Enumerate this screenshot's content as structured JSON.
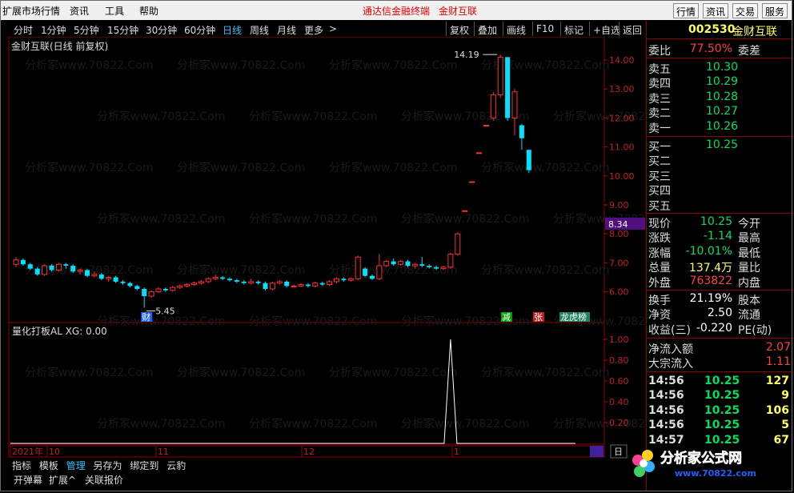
{
  "menubar": {
    "items": [
      "扩展市场行情",
      "资讯",
      "工具",
      "帮助"
    ],
    "banner_left": "通达信金融终端",
    "banner_right": "金财互联",
    "right_buttons": [
      "行情",
      "资讯",
      "交易",
      "服务"
    ]
  },
  "toolbar": {
    "timeframes": [
      "分时",
      "1分钟",
      "5分钟",
      "15分钟",
      "30分钟",
      "60分钟",
      "日线",
      "周线",
      "月线",
      "更多"
    ],
    "active": "日线",
    "more_arrow": ">",
    "buttons": [
      "复权",
      "叠加",
      "画线",
      "F10",
      "标记",
      "+自选",
      "返回"
    ]
  },
  "chart": {
    "title": "金财互联(日线 前复权)",
    "high_label": "14.19",
    "low_label": "5.45",
    "current_price_tag": "8.34",
    "price_axis": [
      "14.00",
      "13.00",
      "12.00",
      "11.00",
      "10.00",
      "9.00",
      "8.00",
      "7.00",
      "6.00"
    ],
    "date_axis": [
      "2021年",
      "10",
      "11",
      "12",
      "1"
    ],
    "markers": [
      {
        "label": "财",
        "color": "#2060ff"
      },
      {
        "label": "减",
        "color": "#00a000"
      },
      {
        "label": "张",
        "color": "#c02020"
      },
      {
        "label": "龙虎榜",
        "color": "#208060"
      }
    ],
    "watermark": "分析家www.70822.Com"
  },
  "indicator": {
    "title": "量化打板AL  XG: 0.00",
    "axis": [
      "1.00",
      "0.80",
      "0.60",
      "0.40",
      "0.20"
    ]
  },
  "bottom": {
    "tabs": [
      "指标",
      "模板",
      "管理",
      "另存为",
      "绑定到",
      "云豹"
    ],
    "tabs2": [
      "开弹幕",
      "扩展^",
      "关联报价"
    ],
    "right_btn": "日"
  },
  "quote": {
    "code": "002530",
    "name": "金财互联",
    "weibi_label": "委比",
    "weibi": "77.50%",
    "weicha_label": "委差",
    "asks": [
      {
        "label": "卖五",
        "price": "10.30"
      },
      {
        "label": "卖四",
        "price": "10.29"
      },
      {
        "label": "卖三",
        "price": "10.28"
      },
      {
        "label": "卖二",
        "price": "10.27"
      },
      {
        "label": "卖一",
        "price": "10.26"
      }
    ],
    "bids": [
      {
        "label": "买一",
        "price": "10.25"
      },
      {
        "label": "买二",
        "price": ""
      },
      {
        "label": "买三",
        "price": ""
      },
      {
        "label": "买四",
        "price": ""
      },
      {
        "label": "买五",
        "price": ""
      }
    ],
    "stats": [
      {
        "l": "现价",
        "v": "10.25",
        "c": "grn",
        "r": "今开"
      },
      {
        "l": "涨跌",
        "v": "-1.14",
        "c": "grn",
        "r": "最高"
      },
      {
        "l": "涨幅",
        "v": "-10.01%",
        "c": "grn",
        "r": "最低"
      },
      {
        "l": "总量",
        "v": "137.4万",
        "c": "yel",
        "r": "量比"
      },
      {
        "l": "外盘",
        "v": "763822",
        "c": "red",
        "r": "内盘"
      }
    ],
    "stats2": [
      {
        "l": "换手",
        "v": "21.19%",
        "r": "股本"
      },
      {
        "l": "净资",
        "v": "2.50",
        "r": "流通"
      },
      {
        "l": "收益(三)",
        "v": "-0.220",
        "r": "PE(动)"
      }
    ],
    "flow": [
      {
        "l": "净流入额",
        "v": "2.07"
      },
      {
        "l": "大宗流入",
        "v": "1.11"
      }
    ],
    "ticks": [
      {
        "t": "14:56",
        "p": "10.25",
        "v": "127"
      },
      {
        "t": "14:56",
        "p": "10.25",
        "v": "9"
      },
      {
        "t": "14:56",
        "p": "10.25",
        "v": "106"
      },
      {
        "t": "14:56",
        "p": "10.25",
        "v": "5"
      },
      {
        "t": "14:57",
        "p": "10.25",
        "v": "67"
      }
    ]
  },
  "logo": {
    "text": "分析家公式网",
    "url": "www.70822.com"
  }
}
